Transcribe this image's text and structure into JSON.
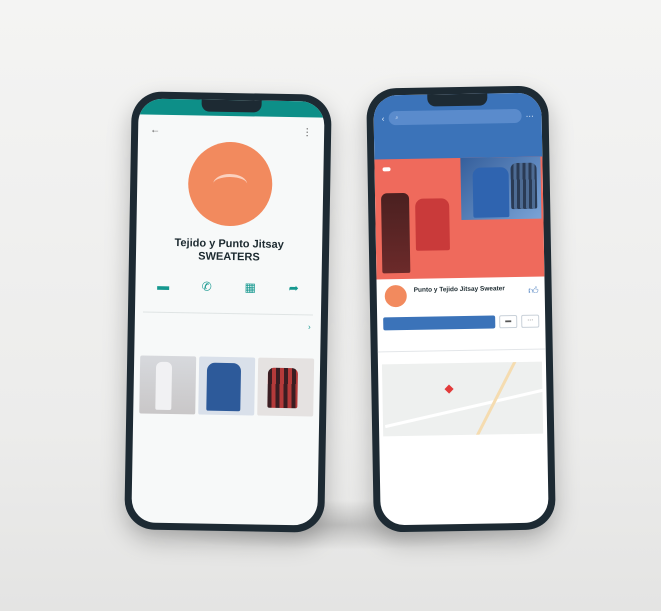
{
  "left_phone": {
    "status_left": "",
    "status_right": "",
    "back_icon": "arrow-left-icon",
    "more_icon": "more-vertical-icon",
    "business_name": "Tejido y Punto Jitsay SWEATERS",
    "phone_number": "",
    "hours": "",
    "website": "",
    "actions": [
      {
        "icon": "message-icon",
        "label": ""
      },
      {
        "icon": "phone-icon",
        "label": ""
      },
      {
        "icon": "store-icon",
        "label": ""
      },
      {
        "icon": "share-icon",
        "label": ""
      }
    ],
    "catalog_row": "",
    "products_title": "",
    "products_see_all": "",
    "accent": "#15988f"
  },
  "right_phone": {
    "search_placeholder": "",
    "breadcrumb": "",
    "cover_tag": "",
    "cover_text": "",
    "page_name": "Punto y Tejido Jitsay Sweater",
    "page_sub": "",
    "like_label": "",
    "primary_button": "",
    "info": "",
    "tabs": [
      "",
      "",
      "",
      ""
    ],
    "map_title": "",
    "map_link": "",
    "address": "",
    "extra": "",
    "accent": "#3b73b9",
    "cover_color": "#ef6a5c"
  }
}
